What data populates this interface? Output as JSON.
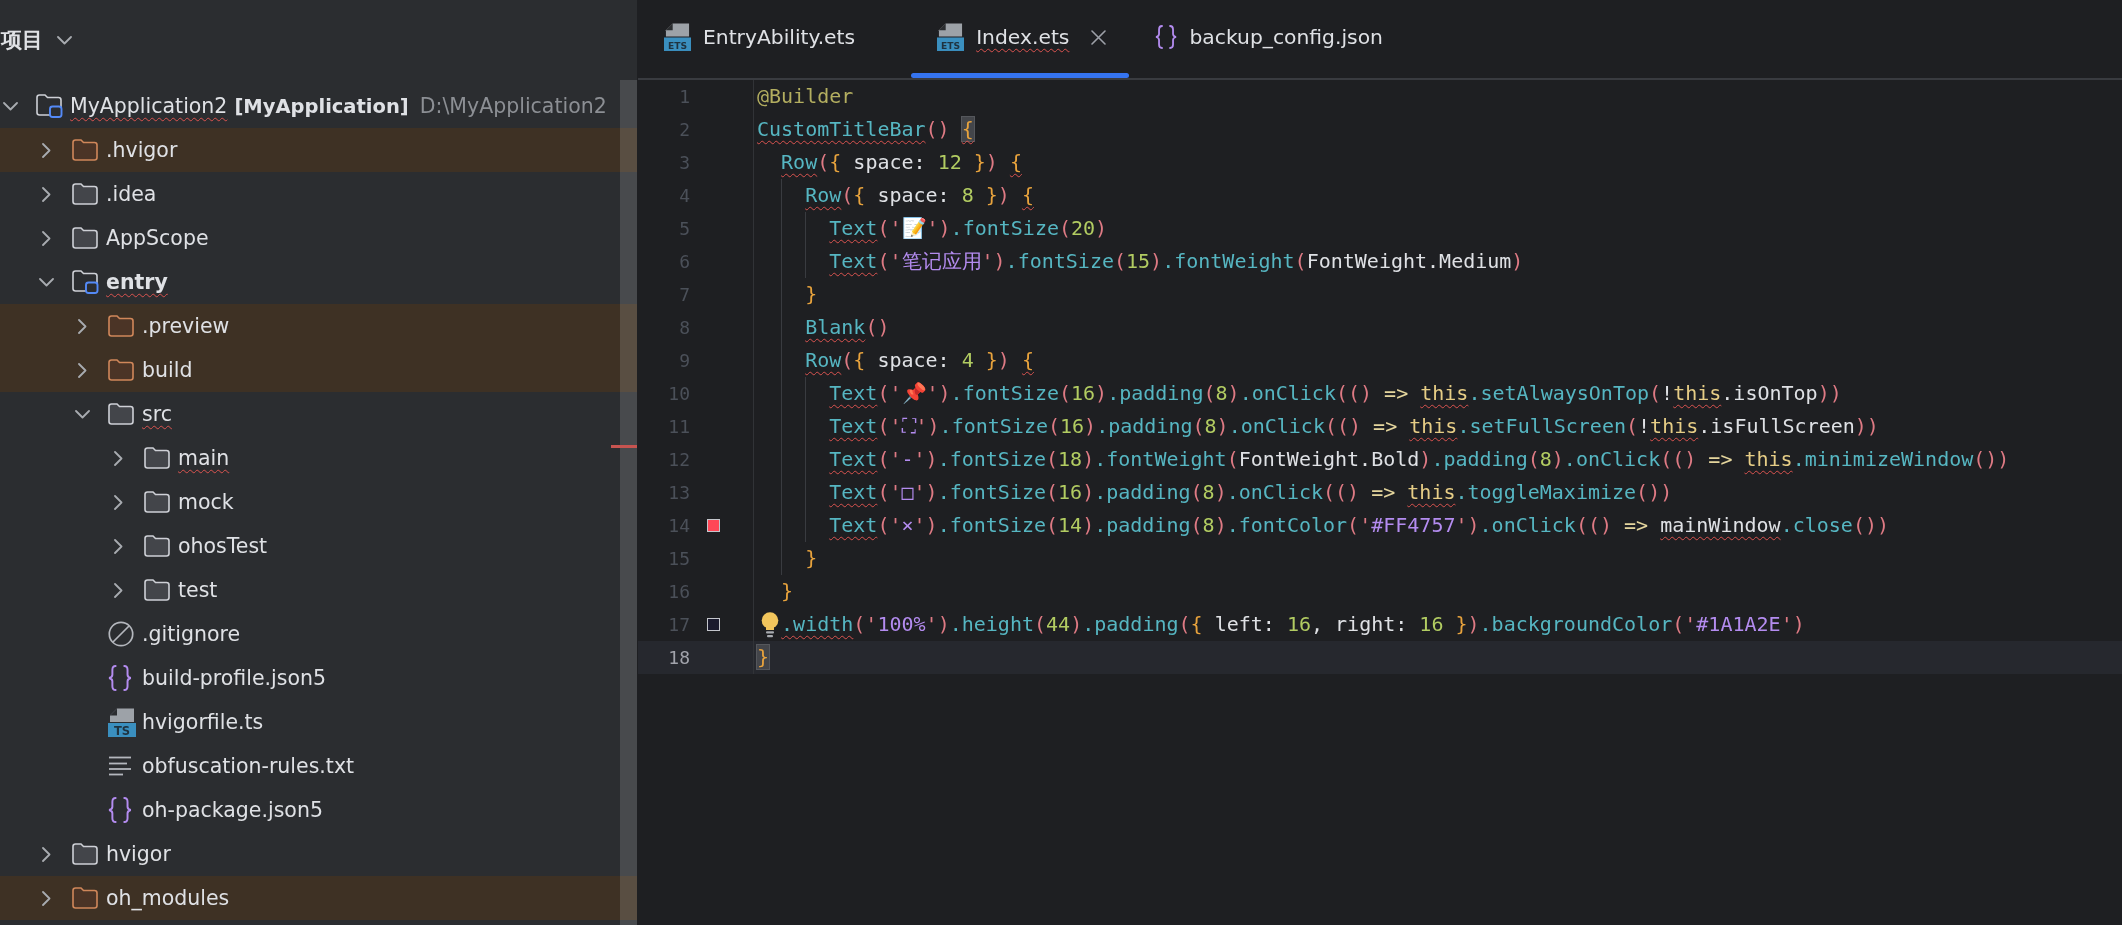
{
  "tree": {
    "title": "项目",
    "items": [
      {
        "kind": "project",
        "label": "MyApplication2",
        "module_label": "[MyApplication]",
        "path": "D:\\MyApplication2",
        "expanded": true,
        "excluded": false,
        "typo": true,
        "children": [
          {
            "kind": "folder",
            "label": ".hvigor",
            "expanded": false,
            "excluded": true,
            "typo": false
          },
          {
            "kind": "folder",
            "label": ".idea",
            "expanded": false,
            "excluded": false,
            "typo": false
          },
          {
            "kind": "folder",
            "label": "AppScope",
            "expanded": false,
            "excluded": false,
            "typo": false
          },
          {
            "kind": "module",
            "label": "entry",
            "expanded": true,
            "excluded": false,
            "typo": true,
            "children": [
              {
                "kind": "folder",
                "label": ".preview",
                "expanded": false,
                "excluded": true,
                "typo": false
              },
              {
                "kind": "folder",
                "label": "build",
                "expanded": false,
                "excluded": true,
                "typo": false
              },
              {
                "kind": "folder",
                "label": "src",
                "expanded": true,
                "excluded": false,
                "typo": true,
                "children": [
                  {
                    "kind": "folder",
                    "label": "main",
                    "expanded": false,
                    "excluded": false,
                    "typo": true
                  },
                  {
                    "kind": "folder",
                    "label": "mock",
                    "expanded": false,
                    "excluded": false,
                    "typo": false
                  },
                  {
                    "kind": "folder",
                    "label": "ohosTest",
                    "expanded": false,
                    "excluded": false,
                    "typo": false
                  },
                  {
                    "kind": "folder",
                    "label": "test",
                    "expanded": false,
                    "excluded": false,
                    "typo": false
                  }
                ]
              },
              {
                "kind": "ignore_file",
                "label": ".gitignore",
                "excluded": false,
                "typo": false
              },
              {
                "kind": "json_file",
                "label": "build-profile.json5",
                "excluded": false,
                "typo": false
              },
              {
                "kind": "ts_file",
                "badge": "TS",
                "label": "hvigorfile.ts",
                "excluded": false,
                "typo": false
              },
              {
                "kind": "text_file",
                "label": "obfuscation-rules.txt",
                "excluded": false,
                "typo": false
              },
              {
                "kind": "json_file",
                "label": "oh-package.json5",
                "excluded": false,
                "typo": false
              }
            ]
          },
          {
            "kind": "folder",
            "label": "hvigor",
            "expanded": false,
            "excluded": false,
            "typo": false
          },
          {
            "kind": "folder",
            "label": "oh_modules",
            "expanded": false,
            "excluded": true,
            "typo": false
          }
        ]
      }
    ]
  },
  "editor": {
    "tabs": [
      {
        "kind": "ets",
        "badge": "ETS",
        "label": "EntryAbility.ets",
        "selected": false,
        "typo": false
      },
      {
        "kind": "ets",
        "badge": "ETS",
        "label": "Index.ets",
        "selected": true,
        "typo": true
      },
      {
        "kind": "json",
        "label": "backup_config.json",
        "selected": false,
        "typo": false
      }
    ],
    "lines": [
      {
        "number": "1",
        "current": false,
        "bulb": false,
        "tokens": [
          {
            "kind": "annotation",
            "text": "@Builder",
            "typo": false
          }
        ]
      },
      {
        "number": "2",
        "current": false,
        "bulb": false,
        "tokens": [
          {
            "kind": "fn",
            "text": "CustomTitleBar",
            "typo": true
          },
          {
            "kind": "paren",
            "text": "() ",
            "typo": false
          },
          {
            "kind": "brace_match",
            "text": "{",
            "typo": true
          }
        ],
        "children": [
          {
            "number": "3",
            "current": false,
            "bulb": false,
            "tokens": [
              {
                "kind": "fn",
                "text": "Row",
                "typo": true
              },
              {
                "kind": "paren",
                "text": "(",
                "typo": false
              },
              {
                "kind": "brace",
                "text": "{",
                "typo": false
              },
              {
                "kind": "plain",
                "text": " space: ",
                "typo": false
              },
              {
                "kind": "number",
                "text": "12 ",
                "typo": false
              },
              {
                "kind": "brace",
                "text": "}",
                "typo": false
              },
              {
                "kind": "paren",
                "text": ") ",
                "typo": false
              },
              {
                "kind": "brace",
                "text": "{",
                "typo": true
              }
            ],
            "children": [
              {
                "number": "4",
                "current": false,
                "bulb": false,
                "tokens": [
                  {
                    "kind": "fn",
                    "text": "Row",
                    "typo": true
                  },
                  {
                    "kind": "paren",
                    "text": "(",
                    "typo": false
                  },
                  {
                    "kind": "brace",
                    "text": "{",
                    "typo": false
                  },
                  {
                    "kind": "plain",
                    "text": " space: ",
                    "typo": false
                  },
                  {
                    "kind": "number",
                    "text": "8 ",
                    "typo": false
                  },
                  {
                    "kind": "brace",
                    "text": "}",
                    "typo": false
                  },
                  {
                    "kind": "paren",
                    "text": ") ",
                    "typo": false
                  },
                  {
                    "kind": "brace",
                    "text": "{",
                    "typo": true
                  }
                ],
                "children": [
                  {
                    "number": "5",
                    "current": false,
                    "bulb": false,
                    "tokens": [
                      {
                        "kind": "fn",
                        "text": "Text",
                        "typo": true
                      },
                      {
                        "kind": "paren",
                        "text": "('",
                        "typo": false
                      },
                      {
                        "kind": "string",
                        "text": "📝",
                        "typo": false
                      },
                      {
                        "kind": "paren",
                        "text": "')",
                        "typo": false
                      },
                      {
                        "kind": "fn",
                        "text": ".fontSize",
                        "typo": false
                      },
                      {
                        "kind": "paren",
                        "text": "(",
                        "typo": false
                      },
                      {
                        "kind": "number",
                        "text": "20",
                        "typo": false
                      },
                      {
                        "kind": "paren",
                        "text": ")",
                        "typo": false
                      }
                    ]
                  },
                  {
                    "number": "6",
                    "current": false,
                    "bulb": false,
                    "tokens": [
                      {
                        "kind": "fn",
                        "text": "Text",
                        "typo": true
                      },
                      {
                        "kind": "paren",
                        "text": "('",
                        "typo": false
                      },
                      {
                        "kind": "string",
                        "text": "笔记应用",
                        "typo": false
                      },
                      {
                        "kind": "paren",
                        "text": "')",
                        "typo": false
                      },
                      {
                        "kind": "fn",
                        "text": ".fontSize",
                        "typo": false
                      },
                      {
                        "kind": "paren",
                        "text": "(",
                        "typo": false
                      },
                      {
                        "kind": "number",
                        "text": "15",
                        "typo": false
                      },
                      {
                        "kind": "paren",
                        "text": ")",
                        "typo": false
                      },
                      {
                        "kind": "fn",
                        "text": ".fontWeight",
                        "typo": false
                      },
                      {
                        "kind": "paren",
                        "text": "(",
                        "typo": false
                      },
                      {
                        "kind": "plain",
                        "text": "FontWeight.Medium",
                        "typo": false
                      },
                      {
                        "kind": "paren",
                        "text": ")",
                        "typo": false
                      }
                    ]
                  }
                ]
              },
              {
                "number": "7",
                "current": false,
                "bulb": false,
                "tokens": [
                  {
                    "kind": "brace",
                    "text": "}",
                    "typo": false
                  }
                ]
              },
              {
                "number": "8",
                "current": false,
                "bulb": false,
                "tokens": [
                  {
                    "kind": "fn",
                    "text": "Blank",
                    "typo": true
                  },
                  {
                    "kind": "paren",
                    "text": "()",
                    "typo": false
                  }
                ]
              },
              {
                "number": "9",
                "current": false,
                "bulb": false,
                "tokens": [
                  {
                    "kind": "fn",
                    "text": "Row",
                    "typo": true
                  },
                  {
                    "kind": "paren",
                    "text": "(",
                    "typo": false
                  },
                  {
                    "kind": "brace",
                    "text": "{",
                    "typo": false
                  },
                  {
                    "kind": "plain",
                    "text": " space: ",
                    "typo": false
                  },
                  {
                    "kind": "number",
                    "text": "4 ",
                    "typo": false
                  },
                  {
                    "kind": "brace",
                    "text": "}",
                    "typo": false
                  },
                  {
                    "kind": "paren",
                    "text": ") ",
                    "typo": false
                  },
                  {
                    "kind": "brace",
                    "text": "{",
                    "typo": true
                  }
                ],
                "children": [
                  {
                    "number": "10",
                    "current": false,
                    "bulb": false,
                    "tokens": [
                      {
                        "kind": "fn",
                        "text": "Text",
                        "typo": true
                      },
                      {
                        "kind": "paren",
                        "text": "('",
                        "typo": false
                      },
                      {
                        "kind": "string",
                        "text": "📌",
                        "typo": false
                      },
                      {
                        "kind": "paren",
                        "text": "')",
                        "typo": false
                      },
                      {
                        "kind": "fn",
                        "text": ".fontSize",
                        "typo": false
                      },
                      {
                        "kind": "paren",
                        "text": "(",
                        "typo": false
                      },
                      {
                        "kind": "number",
                        "text": "16",
                        "typo": false
                      },
                      {
                        "kind": "paren",
                        "text": ")",
                        "typo": false
                      },
                      {
                        "kind": "fn",
                        "text": ".padding",
                        "typo": false
                      },
                      {
                        "kind": "paren",
                        "text": "(",
                        "typo": false
                      },
                      {
                        "kind": "number",
                        "text": "8",
                        "typo": false
                      },
                      {
                        "kind": "paren",
                        "text": ")",
                        "typo": false
                      },
                      {
                        "kind": "fn",
                        "text": ".onClick",
                        "typo": false
                      },
                      {
                        "kind": "paren",
                        "text": "(()",
                        "typo": false
                      },
                      {
                        "kind": "operator",
                        "text": " => ",
                        "typo": false
                      },
                      {
                        "kind": "keyword",
                        "text": "this",
                        "typo": true
                      },
                      {
                        "kind": "fn",
                        "text": ".setAlwaysOnTop",
                        "typo": false
                      },
                      {
                        "kind": "paren",
                        "text": "(",
                        "typo": false
                      },
                      {
                        "kind": "plain",
                        "text": "!",
                        "typo": false
                      },
                      {
                        "kind": "keyword",
                        "text": "this",
                        "typo": true
                      },
                      {
                        "kind": "plain",
                        "text": ".isOnTop",
                        "typo": false
                      },
                      {
                        "kind": "paren",
                        "text": "))",
                        "typo": false
                      }
                    ]
                  },
                  {
                    "number": "11",
                    "current": false,
                    "bulb": false,
                    "tokens": [
                      {
                        "kind": "fn",
                        "text": "Text",
                        "typo": true
                      },
                      {
                        "kind": "paren",
                        "text": "('",
                        "typo": false
                      },
                      {
                        "kind": "string",
                        "text": "⛶",
                        "typo": false
                      },
                      {
                        "kind": "paren",
                        "text": "')",
                        "typo": false
                      },
                      {
                        "kind": "fn",
                        "text": ".fontSize",
                        "typo": false
                      },
                      {
                        "kind": "paren",
                        "text": "(",
                        "typo": false
                      },
                      {
                        "kind": "number",
                        "text": "16",
                        "typo": false
                      },
                      {
                        "kind": "paren",
                        "text": ")",
                        "typo": false
                      },
                      {
                        "kind": "fn",
                        "text": ".padding",
                        "typo": false
                      },
                      {
                        "kind": "paren",
                        "text": "(",
                        "typo": false
                      },
                      {
                        "kind": "number",
                        "text": "8",
                        "typo": false
                      },
                      {
                        "kind": "paren",
                        "text": ")",
                        "typo": false
                      },
                      {
                        "kind": "fn",
                        "text": ".onClick",
                        "typo": false
                      },
                      {
                        "kind": "paren",
                        "text": "(()",
                        "typo": false
                      },
                      {
                        "kind": "operator",
                        "text": " => ",
                        "typo": false
                      },
                      {
                        "kind": "keyword",
                        "text": "this",
                        "typo": true
                      },
                      {
                        "kind": "fn",
                        "text": ".setFullScreen",
                        "typo": false
                      },
                      {
                        "kind": "paren",
                        "text": "(",
                        "typo": false
                      },
                      {
                        "kind": "plain",
                        "text": "!",
                        "typo": false
                      },
                      {
                        "kind": "keyword",
                        "text": "this",
                        "typo": true
                      },
                      {
                        "kind": "plain",
                        "text": ".isFullScreen",
                        "typo": false
                      },
                      {
                        "kind": "paren",
                        "text": "))",
                        "typo": false
                      }
                    ]
                  },
                  {
                    "number": "12",
                    "current": false,
                    "bulb": false,
                    "tokens": [
                      {
                        "kind": "fn",
                        "text": "Text",
                        "typo": true
                      },
                      {
                        "kind": "paren",
                        "text": "('",
                        "typo": false
                      },
                      {
                        "kind": "string",
                        "text": "-",
                        "typo": false
                      },
                      {
                        "kind": "paren",
                        "text": "')",
                        "typo": false
                      },
                      {
                        "kind": "fn",
                        "text": ".fontSize",
                        "typo": false
                      },
                      {
                        "kind": "paren",
                        "text": "(",
                        "typo": false
                      },
                      {
                        "kind": "number",
                        "text": "18",
                        "typo": false
                      },
                      {
                        "kind": "paren",
                        "text": ")",
                        "typo": false
                      },
                      {
                        "kind": "fn",
                        "text": ".fontWeight",
                        "typo": false
                      },
                      {
                        "kind": "paren",
                        "text": "(",
                        "typo": false
                      },
                      {
                        "kind": "plain",
                        "text": "FontWeight.Bold",
                        "typo": false
                      },
                      {
                        "kind": "paren",
                        "text": ")",
                        "typo": false
                      },
                      {
                        "kind": "fn",
                        "text": ".padding",
                        "typo": false
                      },
                      {
                        "kind": "paren",
                        "text": "(",
                        "typo": false
                      },
                      {
                        "kind": "number",
                        "text": "8",
                        "typo": false
                      },
                      {
                        "kind": "paren",
                        "text": ")",
                        "typo": false
                      },
                      {
                        "kind": "fn",
                        "text": ".onClick",
                        "typo": false
                      },
                      {
                        "kind": "paren",
                        "text": "(()",
                        "typo": false
                      },
                      {
                        "kind": "operator",
                        "text": " => ",
                        "typo": false
                      },
                      {
                        "kind": "keyword",
                        "text": "this",
                        "typo": true
                      },
                      {
                        "kind": "fn",
                        "text": ".minimizeWindow",
                        "typo": false
                      },
                      {
                        "kind": "paren",
                        "text": "())",
                        "typo": false
                      }
                    ]
                  },
                  {
                    "number": "13",
                    "current": false,
                    "bulb": false,
                    "tokens": [
                      {
                        "kind": "fn",
                        "text": "Text",
                        "typo": true
                      },
                      {
                        "kind": "paren",
                        "text": "('",
                        "typo": false
                      },
                      {
                        "kind": "string",
                        "text": "□",
                        "typo": false
                      },
                      {
                        "kind": "paren",
                        "text": "')",
                        "typo": false
                      },
                      {
                        "kind": "fn",
                        "text": ".fontSize",
                        "typo": false
                      },
                      {
                        "kind": "paren",
                        "text": "(",
                        "typo": false
                      },
                      {
                        "kind": "number",
                        "text": "16",
                        "typo": false
                      },
                      {
                        "kind": "paren",
                        "text": ")",
                        "typo": false
                      },
                      {
                        "kind": "fn",
                        "text": ".padding",
                        "typo": false
                      },
                      {
                        "kind": "paren",
                        "text": "(",
                        "typo": false
                      },
                      {
                        "kind": "number",
                        "text": "8",
                        "typo": false
                      },
                      {
                        "kind": "paren",
                        "text": ")",
                        "typo": false
                      },
                      {
                        "kind": "fn",
                        "text": ".onClick",
                        "typo": false
                      },
                      {
                        "kind": "paren",
                        "text": "(()",
                        "typo": false
                      },
                      {
                        "kind": "operator",
                        "text": " => ",
                        "typo": false
                      },
                      {
                        "kind": "keyword",
                        "text": "this",
                        "typo": true
                      },
                      {
                        "kind": "fn",
                        "text": ".toggleMaximize",
                        "typo": false
                      },
                      {
                        "kind": "paren",
                        "text": "())",
                        "typo": false
                      }
                    ]
                  },
                  {
                    "number": "14",
                    "current": false,
                    "bulb": false,
                    "swatch": {
                      "color": "#ff4757"
                    },
                    "tokens": [
                      {
                        "kind": "fn",
                        "text": "Text",
                        "typo": true
                      },
                      {
                        "kind": "paren",
                        "text": "('",
                        "typo": false
                      },
                      {
                        "kind": "string",
                        "text": "×",
                        "typo": false
                      },
                      {
                        "kind": "paren",
                        "text": "')",
                        "typo": false
                      },
                      {
                        "kind": "fn",
                        "text": ".fontSize",
                        "typo": false
                      },
                      {
                        "kind": "paren",
                        "text": "(",
                        "typo": false
                      },
                      {
                        "kind": "number",
                        "text": "14",
                        "typo": false
                      },
                      {
                        "kind": "paren",
                        "text": ")",
                        "typo": false
                      },
                      {
                        "kind": "fn",
                        "text": ".padding",
                        "typo": false
                      },
                      {
                        "kind": "paren",
                        "text": "(",
                        "typo": false
                      },
                      {
                        "kind": "number",
                        "text": "8",
                        "typo": false
                      },
                      {
                        "kind": "paren",
                        "text": ")",
                        "typo": false
                      },
                      {
                        "kind": "fn",
                        "text": ".fontColor",
                        "typo": false
                      },
                      {
                        "kind": "paren",
                        "text": "('",
                        "typo": false
                      },
                      {
                        "kind": "string",
                        "text": "#FF4757",
                        "typo": false
                      },
                      {
                        "kind": "paren",
                        "text": "')",
                        "typo": false
                      },
                      {
                        "kind": "fn",
                        "text": ".onClick",
                        "typo": false
                      },
                      {
                        "kind": "paren",
                        "text": "(()",
                        "typo": false
                      },
                      {
                        "kind": "operator",
                        "text": " => ",
                        "typo": false
                      },
                      {
                        "kind": "plain",
                        "text": "mainWindow",
                        "typo": true
                      },
                      {
                        "kind": "fn",
                        "text": ".close",
                        "typo": false
                      },
                      {
                        "kind": "paren",
                        "text": "())",
                        "typo": false
                      }
                    ]
                  }
                ]
              },
              {
                "number": "15",
                "current": false,
                "bulb": false,
                "tokens": [
                  {
                    "kind": "brace",
                    "text": "}",
                    "typo": false
                  }
                ]
              }
            ]
          },
          {
            "number": "16",
            "current": false,
            "bulb": false,
            "tokens": [
              {
                "kind": "brace",
                "text": "}",
                "typo": false
              }
            ]
          },
          {
            "number": "17",
            "current": false,
            "bulb": true,
            "swatch": {
              "color": "#1a1a2e"
            },
            "tokens": [
              {
                "kind": "fn",
                "text": ".width",
                "typo": true
              },
              {
                "kind": "paren",
                "text": "('",
                "typo": false
              },
              {
                "kind": "string",
                "text": "100%",
                "typo": false
              },
              {
                "kind": "paren",
                "text": "')",
                "typo": false
              },
              {
                "kind": "fn",
                "text": ".height",
                "typo": false
              },
              {
                "kind": "paren",
                "text": "(",
                "typo": false
              },
              {
                "kind": "number",
                "text": "44",
                "typo": false
              },
              {
                "kind": "paren",
                "text": ")",
                "typo": false
              },
              {
                "kind": "fn",
                "text": ".padding",
                "typo": false
              },
              {
                "kind": "paren",
                "text": "(",
                "typo": false
              },
              {
                "kind": "brace",
                "text": "{",
                "typo": false
              },
              {
                "kind": "plain",
                "text": " left: ",
                "typo": false
              },
              {
                "kind": "number",
                "text": "16",
                "typo": false
              },
              {
                "kind": "plain",
                "text": ", right: ",
                "typo": false
              },
              {
                "kind": "number",
                "text": "16 ",
                "typo": false
              },
              {
                "kind": "brace",
                "text": "}",
                "typo": false
              },
              {
                "kind": "paren",
                "text": ")",
                "typo": false
              },
              {
                "kind": "fn",
                "text": ".backgroundColor",
                "typo": false
              },
              {
                "kind": "paren",
                "text": "('",
                "typo": false
              },
              {
                "kind": "string",
                "text": "#1A1A2E",
                "typo": false
              },
              {
                "kind": "paren",
                "text": "')",
                "typo": false
              }
            ]
          }
        ]
      },
      {
        "number": "18",
        "current": true,
        "bulb": false,
        "tokens": [
          {
            "kind": "brace_match",
            "text": "}",
            "typo": false
          }
        ]
      }
    ]
  }
}
